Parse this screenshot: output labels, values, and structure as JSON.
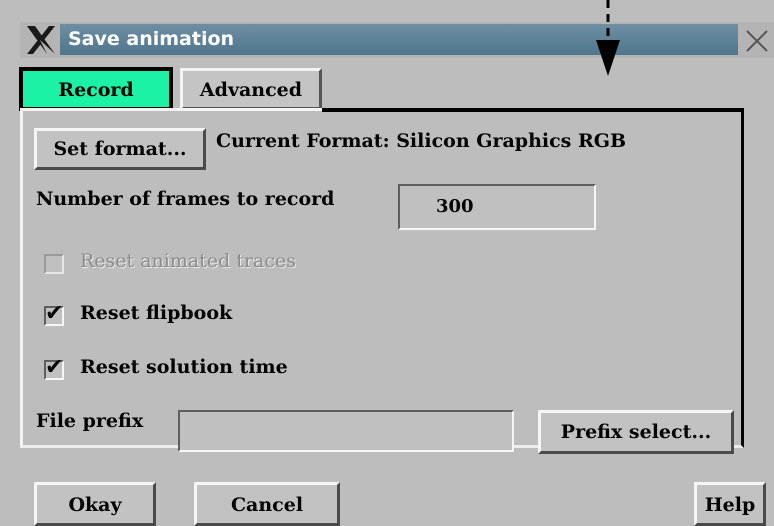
{
  "window": {
    "title": "Save animation"
  },
  "tabs": [
    {
      "label": "Record",
      "active": true
    },
    {
      "label": "Advanced",
      "active": false
    }
  ],
  "record": {
    "set_format_label": "Set format...",
    "current_format": "Current Format: Silicon Graphics RGB",
    "frames_label": "Number of frames to record",
    "frames_value": "300",
    "reset_traces": {
      "label": "Reset animated traces",
      "checked": false,
      "enabled": false
    },
    "reset_flipbook": {
      "label": "Reset flipbook",
      "checked": true
    },
    "reset_solution_time": {
      "label": "Reset solution time",
      "checked": true
    },
    "file_prefix_label": "File prefix",
    "file_prefix_value": "",
    "prefix_select_label": "Prefix select..."
  },
  "footer": {
    "okay": "Okay",
    "cancel": "Cancel",
    "help": "Help"
  },
  "colors": {
    "active_tab": "#1cf2a6",
    "title_strip": "#5f8298",
    "dialog_bg": "#bdbdbd"
  },
  "icons": {
    "window_menu": "x-logo-icon",
    "close": "close-icon",
    "annotation": "down-arrow-icon",
    "check": "checkmark-icon"
  }
}
